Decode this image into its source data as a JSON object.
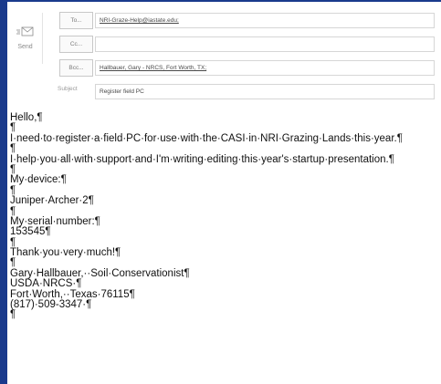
{
  "compose": {
    "send_label": "Send",
    "to_button": "To...",
    "cc_button": "Cc...",
    "bcc_button": "Bcc...",
    "subject_label": "Subject",
    "to_value": "NRI-Graze-Help@iastate.edu;",
    "cc_value": "",
    "bcc_value": "Hallbauer, Gary - NRCS, Fort Worth, TX;",
    "subject_value": "Register field PC"
  },
  "body_lines": [
    "Hello,¶",
    "¶",
    "I·need·to·register·a·field·PC·for·use·with·the·CASI·in·NRI·Grazing·Lands·this·year.¶",
    "¶",
    "I·help·you·all·with·support·and·I'm·writing·editing·this·year's·startup·presentation.¶",
    "¶",
    "My·device:¶",
    "¶",
    "Juniper·Archer·2¶",
    "¶",
    "My·serial·number:¶",
    "153545¶",
    "¶",
    "Thank·you·very·much!¶",
    "¶",
    "Gary·Hallbauer,··Soil·Conservationist¶",
    "USDA·NRCS·¶",
    "Fort·Worth,··Texas·76115¶",
    "(817)·509-3347·¶",
    "¶"
  ],
  "colors": {
    "background_border": "#1a3a8c",
    "field_border": "#d6d6d6"
  }
}
